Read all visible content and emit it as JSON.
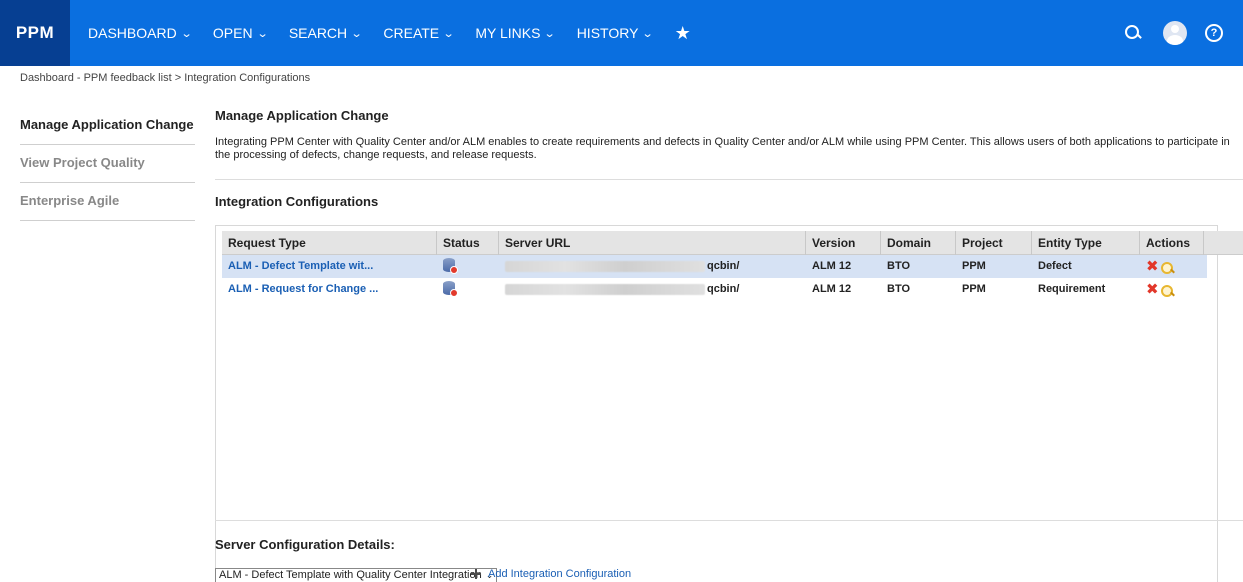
{
  "app": {
    "logo": "PPM"
  },
  "nav": {
    "items": [
      {
        "label": "DASHBOARD"
      },
      {
        "label": "OPEN"
      },
      {
        "label": "SEARCH"
      },
      {
        "label": "CREATE"
      },
      {
        "label": "MY LINKS"
      },
      {
        "label": "HISTORY"
      }
    ],
    "chevron": "⌄",
    "star": "★",
    "help": "?"
  },
  "breadcrumb": {
    "parent": "Dashboard - PPM feedback list",
    "separator": ">",
    "current": "Integration Configurations"
  },
  "sidebar": {
    "items": [
      {
        "label": "Manage Application Change",
        "active": true
      },
      {
        "label": "View Project Quality",
        "active": false
      },
      {
        "label": "Enterprise Agile",
        "active": false
      }
    ]
  },
  "main": {
    "title": "Manage Application Change",
    "description": "Integrating PPM Center with Quality Center and/or ALM enables to create requirements and defects in Quality Center and/or ALM while using PPM Center. This allows users of both applications to participate in the processing of defects, change requests, and release requests.",
    "integration_title": "Integration Configurations"
  },
  "table": {
    "columns": [
      "Request Type",
      "Status",
      "Server URL",
      "Version",
      "Domain",
      "Project",
      "Entity Type",
      "Actions"
    ],
    "rows": [
      {
        "request_type": "ALM - Defect Template wit...",
        "server_url_suffix": "qcbin/",
        "version": "ALM 12",
        "domain": "BTO",
        "project": "PPM",
        "entity_type": "Defect",
        "selected": true
      },
      {
        "request_type": "ALM - Request for Change ...",
        "server_url_suffix": "qcbin/",
        "version": "ALM 12",
        "domain": "BTO",
        "project": "PPM",
        "entity_type": "Requirement",
        "selected": false
      }
    ],
    "delete_glyph": "✖"
  },
  "server_config": {
    "title": "Server Configuration Details:",
    "selected_value": "ALM - Defect Template with Quality Center Integration",
    "select_chevron": "⌄",
    "add_link": "Add Integration Configuration"
  },
  "colors": {
    "nav_bg": "#0a6fe0",
    "logo_bg": "#063f92",
    "link": "#1a5fb4",
    "selected_row": "#d6e2f4",
    "delete": "#e2372a"
  }
}
